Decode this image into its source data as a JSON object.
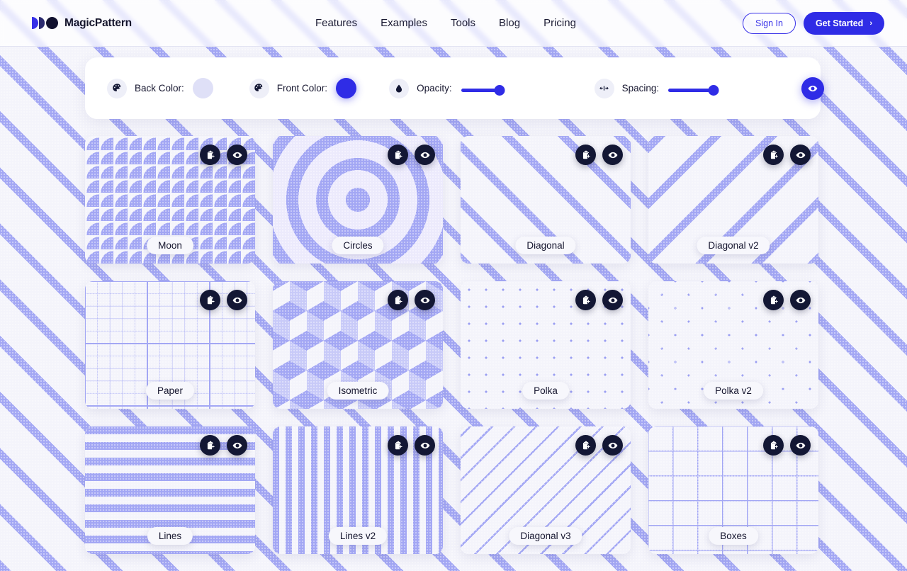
{
  "header": {
    "logo_text": "MagicPattern",
    "nav": [
      {
        "label": "Features"
      },
      {
        "label": "Examples"
      },
      {
        "label": "Tools"
      },
      {
        "label": "Blog"
      },
      {
        "label": "Pricing"
      }
    ],
    "sign_in_label": "Sign In",
    "get_started_label": "Get Started",
    "get_started_chevron": "›"
  },
  "controls": {
    "back_color": {
      "icon": "palette-icon",
      "label": "Back Color:",
      "value": "#dfe0f7"
    },
    "front_color": {
      "icon": "palette-icon",
      "label": "Front Color:",
      "value": "#2f2ce6"
    },
    "opacity": {
      "icon": "droplet-icon",
      "label": "Opacity:",
      "percent": 40,
      "track_width": 135
    },
    "spacing": {
      "icon": "arrows-horizontal-icon",
      "label": "Spacing:",
      "percent": 47,
      "track_width": 135
    },
    "preview_button": {
      "icon": "eye-icon"
    }
  },
  "card_actions": {
    "copy_icon": "clipboard-copy-icon",
    "preview_icon": "eye-icon"
  },
  "patterns": [
    {
      "label": "Moon",
      "pattern_class": "p-moon"
    },
    {
      "label": "Circles",
      "pattern_class": "p-circles"
    },
    {
      "label": "Diagonal",
      "pattern_class": "p-diagonal"
    },
    {
      "label": "Diagonal v2",
      "pattern_class": "p-diagonal-v2"
    },
    {
      "label": "Paper",
      "pattern_class": "p-paper"
    },
    {
      "label": "Isometric",
      "pattern_class": "p-isometric"
    },
    {
      "label": "Polka",
      "pattern_class": "p-polka"
    },
    {
      "label": "Polka v2",
      "pattern_class": "p-polka-v2"
    },
    {
      "label": "Lines",
      "pattern_class": "p-lines"
    },
    {
      "label": "Lines v2",
      "pattern_class": "p-lines-v2"
    },
    {
      "label": "Diagonal v3",
      "pattern_class": "p-diagonal-v3"
    },
    {
      "label": "Boxes",
      "pattern_class": "p-boxes"
    }
  ],
  "theme": {
    "accent": "#2f2ce6",
    "pattern_front": "#a3a7f4",
    "pattern_back": "#f4f4fb",
    "dark": "#131734"
  }
}
